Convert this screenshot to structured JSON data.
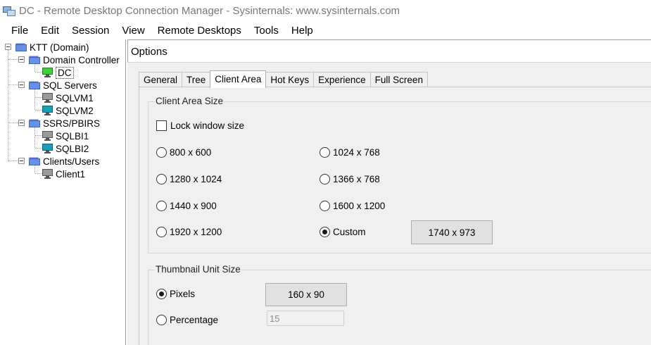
{
  "window": {
    "title": "DC - Remote Desktop Connection Manager - Sysinternals: www.sysinternals.com"
  },
  "menu": [
    "File",
    "Edit",
    "Session",
    "View",
    "Remote Desktops",
    "Tools",
    "Help"
  ],
  "tree": {
    "root": "KTT (Domain)",
    "groups": [
      {
        "label": "Domain Controller",
        "servers": [
          "DC"
        ]
      },
      {
        "label": "SQL Servers",
        "servers": [
          "SQLVM1",
          "SQLVM2"
        ]
      },
      {
        "label": "SSRS/PBIRS",
        "servers": [
          "SQLBI1",
          "SQLBI2"
        ]
      },
      {
        "label": "Clients/Users",
        "servers": [
          "Client1"
        ]
      }
    ],
    "selected": "DC"
  },
  "options": {
    "title": "Options",
    "tabs": [
      "General",
      "Tree",
      "Client Area",
      "Hot Keys",
      "Experience",
      "Full Screen"
    ],
    "active_tab": "Client Area",
    "client_area_size": {
      "label": "Client Area Size",
      "lock_window_size": {
        "label": "Lock window size",
        "checked": false
      },
      "sizes": [
        "800 x 600",
        "1024 x 768",
        "1280 x 1024",
        "1366 x 768",
        "1440 x 900",
        "1600 x 1200",
        "1920 x 1200"
      ],
      "custom_label": "Custom",
      "custom_selected": true,
      "custom_value": "1740 x 973"
    },
    "thumbnail_unit_size": {
      "label": "Thumbnail Unit Size",
      "pixels_label": "Pixels",
      "pixels_selected": true,
      "pixels_value": "160 x 90",
      "percentage_label": "Percentage",
      "percentage_value": "15"
    }
  }
}
